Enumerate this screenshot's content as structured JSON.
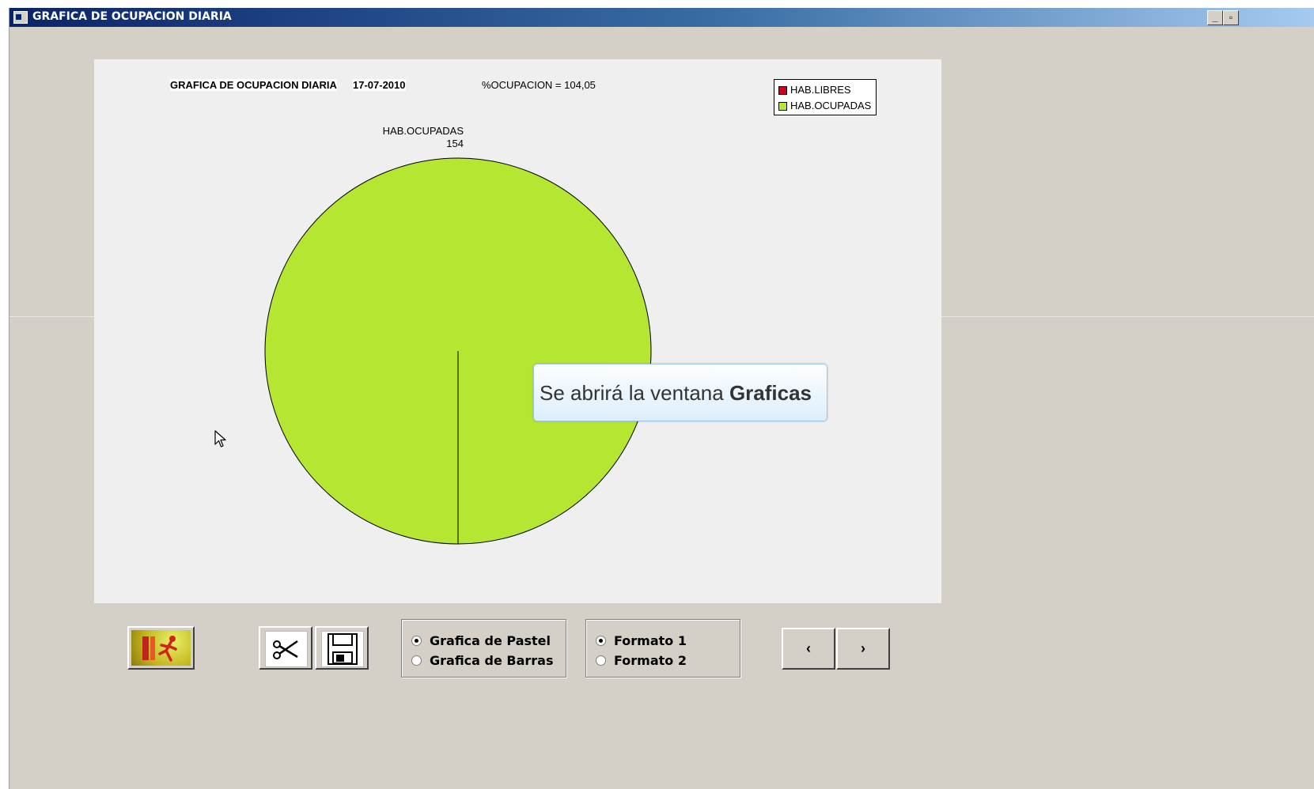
{
  "window": {
    "title": "GRAFICA DE OCUPACION DIARIA",
    "controls": {
      "minimize": "_",
      "restore": "▫"
    }
  },
  "chart": {
    "title": "GRAFICA DE OCUPACION DIARIA",
    "date": "17-07-2010",
    "occupancy_text": "%OCUPACION  = 104,05",
    "slice_label_name": "HAB.OCUPADAS",
    "slice_label_value": "154",
    "legend": [
      {
        "label": "HAB.LIBRES",
        "color": "#d0021b"
      },
      {
        "label": "HAB.OCUPADAS",
        "color": "#b5e631"
      }
    ]
  },
  "chart_data": {
    "type": "pie",
    "title": "GRAFICA DE OCUPACION DIARIA",
    "categories": [
      "HAB.LIBRES",
      "HAB.OCUPADAS"
    ],
    "values": [
      0,
      154
    ],
    "colors": [
      "#d0021b",
      "#b5e631"
    ],
    "legend_position": "top-right"
  },
  "tooltip": {
    "prefix": "Se abrirá la ventana ",
    "bold": "Graficas"
  },
  "toolbar": {
    "exit_icon": "exit-running-man-icon",
    "cut_icon": "scissors-icon",
    "save_icon": "floppy-disk-icon"
  },
  "chart_type_options": {
    "options": [
      "Grafica de Pastel",
      "Grafica de Barras"
    ],
    "selected": "Grafica de Pastel"
  },
  "format_options": {
    "options": [
      "Formato 1",
      "Formato 2"
    ],
    "selected": "Formato 1"
  },
  "navigation": {
    "prev": "‹",
    "next": "›"
  }
}
